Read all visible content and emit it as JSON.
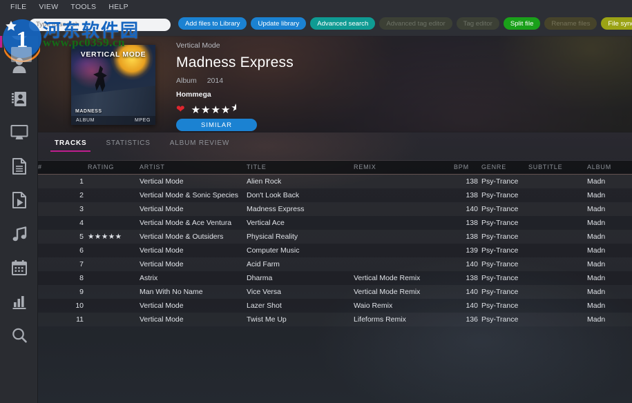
{
  "menubar": {
    "items": [
      "FILE",
      "VIEW",
      "TOOLS",
      "HELP"
    ]
  },
  "search": {
    "placeholder": "Type to search",
    "value": ""
  },
  "toolbar": {
    "buttons": [
      {
        "label": "Add files to Library",
        "style": "blue",
        "enabled": true
      },
      {
        "label": "Update library",
        "style": "blue",
        "enabled": true
      },
      {
        "label": "Advanced search",
        "style": "teal",
        "enabled": true
      },
      {
        "label": "Advanced tag editor",
        "style": "dim",
        "enabled": false
      },
      {
        "label": "Tag editor",
        "style": "dim",
        "enabled": false
      },
      {
        "label": "Split file",
        "style": "green",
        "enabled": true
      },
      {
        "label": "Rename files",
        "style": "dim2",
        "enabled": false
      },
      {
        "label": "File synchro",
        "style": "olive",
        "enabled": true
      }
    ]
  },
  "sidebar": {
    "items": [
      {
        "icon": "disc-icon",
        "label": "Library",
        "active": true
      },
      {
        "icon": "person-icon",
        "label": "Artists",
        "active": false
      },
      {
        "icon": "contact-icon",
        "label": "Contacts",
        "active": false
      },
      {
        "icon": "monitor-icon",
        "label": "Devices",
        "active": false
      },
      {
        "icon": "document-icon",
        "label": "Documents",
        "active": false
      },
      {
        "icon": "video-icon",
        "label": "Videos",
        "active": false
      },
      {
        "icon": "music-icon",
        "label": "Music",
        "active": false
      },
      {
        "icon": "calendar-icon",
        "label": "Calendar",
        "active": false
      },
      {
        "icon": "chart-icon",
        "label": "Stats",
        "active": false
      },
      {
        "icon": "search-icon",
        "label": "Search",
        "active": false
      }
    ]
  },
  "hero": {
    "cover": {
      "title": "VERTICAL MODE",
      "sub": "MADNESS",
      "badge_left": "ALBUM",
      "badge_right": "MPEG"
    },
    "artist": "Vertical Mode",
    "title": "Madness Express",
    "type": "Album",
    "year": "2014",
    "label": "Hommega",
    "favorite": true,
    "rating_stars": "★★★★",
    "rating_half": "★",
    "rating_value": 4.5,
    "similar_button": "SIMILAR"
  },
  "tabs": [
    {
      "label": "TRACKS",
      "active": true
    },
    {
      "label": "STATISTICS",
      "active": false
    },
    {
      "label": "ALBUM REVIEW",
      "active": false
    }
  ],
  "table": {
    "headers": [
      "#",
      "RATING",
      "ARTIST",
      "TITLE",
      "REMIX",
      "BPM",
      "GENRE",
      "SUBTITLE",
      "ALBUM"
    ],
    "rows": [
      {
        "num": "1",
        "rating": "",
        "artist": "Vertical Mode",
        "title": "Alien Rock",
        "remix": "",
        "bpm": "138",
        "genre": "Psy-Trance",
        "subtitle": "",
        "album": "Madn"
      },
      {
        "num": "2",
        "rating": "",
        "artist": "Vertical Mode & Sonic Species",
        "title": "Don't Look Back",
        "remix": "",
        "bpm": "138",
        "genre": "Psy-Trance",
        "subtitle": "",
        "album": "Madn"
      },
      {
        "num": "3",
        "rating": "",
        "artist": "Vertical Mode",
        "title": "Madness Express",
        "remix": "",
        "bpm": "140",
        "genre": "Psy-Trance",
        "subtitle": "",
        "album": "Madn"
      },
      {
        "num": "4",
        "rating": "",
        "artist": "Vertical Mode & Ace Ventura",
        "title": "Vertical Ace",
        "remix": "",
        "bpm": "138",
        "genre": "Psy-Trance",
        "subtitle": "",
        "album": "Madn"
      },
      {
        "num": "5",
        "rating": "★★★★★",
        "artist": "Vertical Mode & Outsiders",
        "title": "Physical Reality",
        "remix": "",
        "bpm": "138",
        "genre": "Psy-Trance",
        "subtitle": "",
        "album": "Madn"
      },
      {
        "num": "6",
        "rating": "",
        "artist": "Vertical Mode",
        "title": "Computer Music",
        "remix": "",
        "bpm": "139",
        "genre": "Psy-Trance",
        "subtitle": "",
        "album": "Madn"
      },
      {
        "num": "7",
        "rating": "",
        "artist": "Vertical Mode",
        "title": "Acid Farm",
        "remix": "",
        "bpm": "140",
        "genre": "Psy-Trance",
        "subtitle": "",
        "album": "Madn"
      },
      {
        "num": "8",
        "rating": "",
        "artist": "Astrix",
        "title": "Dharma",
        "remix": "Vertical Mode Remix",
        "bpm": "138",
        "genre": "Psy-Trance",
        "subtitle": "",
        "album": "Madn"
      },
      {
        "num": "9",
        "rating": "",
        "artist": "Man With No Name",
        "title": "Vice Versa",
        "remix": "Vertical Mode Remix",
        "bpm": "140",
        "genre": "Psy-Trance",
        "subtitle": "",
        "album": "Madn"
      },
      {
        "num": "10",
        "rating": "",
        "artist": "Vertical Mode",
        "title": "Lazer Shot",
        "remix": "Waio Remix",
        "bpm": "140",
        "genre": "Psy-Trance",
        "subtitle": "",
        "album": "Madn"
      },
      {
        "num": "11",
        "rating": "",
        "artist": "Vertical Mode",
        "title": "Twist Me Up",
        "remix": "Lifeforms Remix",
        "bpm": "136",
        "genre": "Psy-Trance",
        "subtitle": "",
        "album": "Madn"
      }
    ]
  },
  "watermark": {
    "cn_text": "河东软件园",
    "url_text": "www.pc0359.cn"
  },
  "colors": {
    "accent_pink": "#c01e8f",
    "accent_blue": "#1b82d2",
    "accent_teal": "#0f9b93",
    "accent_green": "#1aa01a",
    "accent_olive": "#9ba315",
    "heart_red": "#e0262e"
  }
}
